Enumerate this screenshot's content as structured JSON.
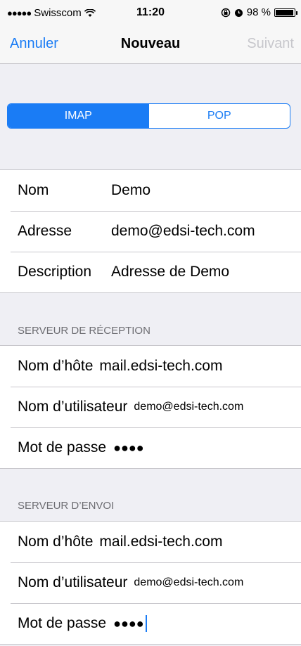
{
  "status_bar": {
    "signal_dots": "●●●●●",
    "carrier": "Swisscom",
    "time": "11:20",
    "battery_percent": "98 %",
    "battery_level": 0.98
  },
  "nav": {
    "cancel_label": "Annuler",
    "title": "Nouveau",
    "next_label": "Suivant"
  },
  "segmented": {
    "options": [
      "IMAP",
      "POP"
    ],
    "selected": "IMAP"
  },
  "account": {
    "name_label": "Nom",
    "name_value": "Demo",
    "address_label": "Adresse",
    "address_value": "demo@edsi-tech.com",
    "description_label": "Description",
    "description_value": "Adresse de Demo"
  },
  "incoming": {
    "header": "SERVEUR DE RÉCEPTION",
    "host_label": "Nom d’hôte",
    "host_value": "mail.edsi-tech.com",
    "user_label": "Nom d’utilisateur",
    "user_value": "demo@edsi-tech.com",
    "password_label": "Mot de passe",
    "password_value": "●●●●"
  },
  "outgoing": {
    "header": "SERVEUR D’ENVOI",
    "host_label": "Nom d’hôte",
    "host_value": "mail.edsi-tech.com",
    "user_label": "Nom d’utilisateur",
    "user_value": "demo@edsi-tech.com",
    "password_label": "Mot de passe",
    "password_value": "●●●●"
  }
}
